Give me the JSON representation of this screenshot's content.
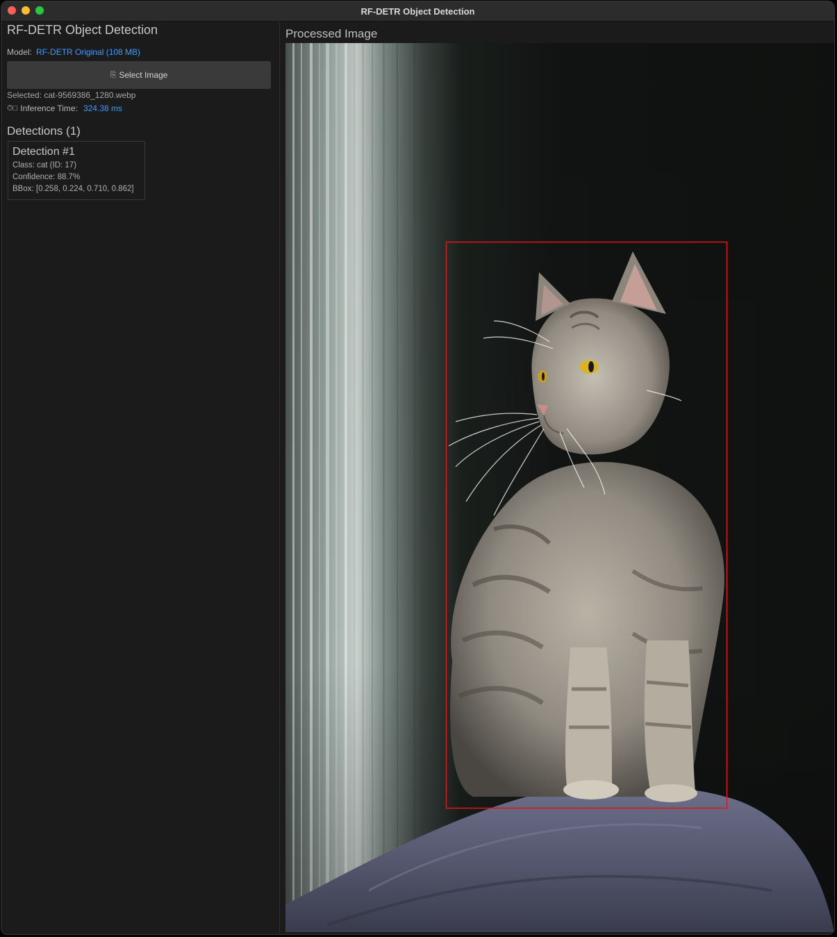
{
  "window": {
    "title": "RF-DETR Object Detection"
  },
  "sidebar": {
    "heading": "RF-DETR Object Detection",
    "model_label": "Model:",
    "model_value": "RF-DETR Original (108 MB)",
    "select_button": {
      "icon": "folder-icon",
      "label": "Select Image"
    },
    "selected_text": "Selected: cat-9569386_1280.webp",
    "inference": {
      "icon": "stopwatch-icon",
      "label": "Inference Time:",
      "value": "324.38 ms"
    },
    "detections_heading": "Detections (1)",
    "detections": [
      {
        "title": "Detection #1",
        "class_line": "Class: cat (ID: 17)",
        "confidence_line": "Confidence: 88.7%",
        "bbox_line": "BBox: [0.258, 0.224, 0.710, 0.862]"
      }
    ]
  },
  "main": {
    "heading": "Processed Image",
    "bbox_color": "#e0161a"
  },
  "colors": {
    "accent": "#3d9bff",
    "background": "#1b1b1b",
    "button": "#3a3a3a"
  }
}
